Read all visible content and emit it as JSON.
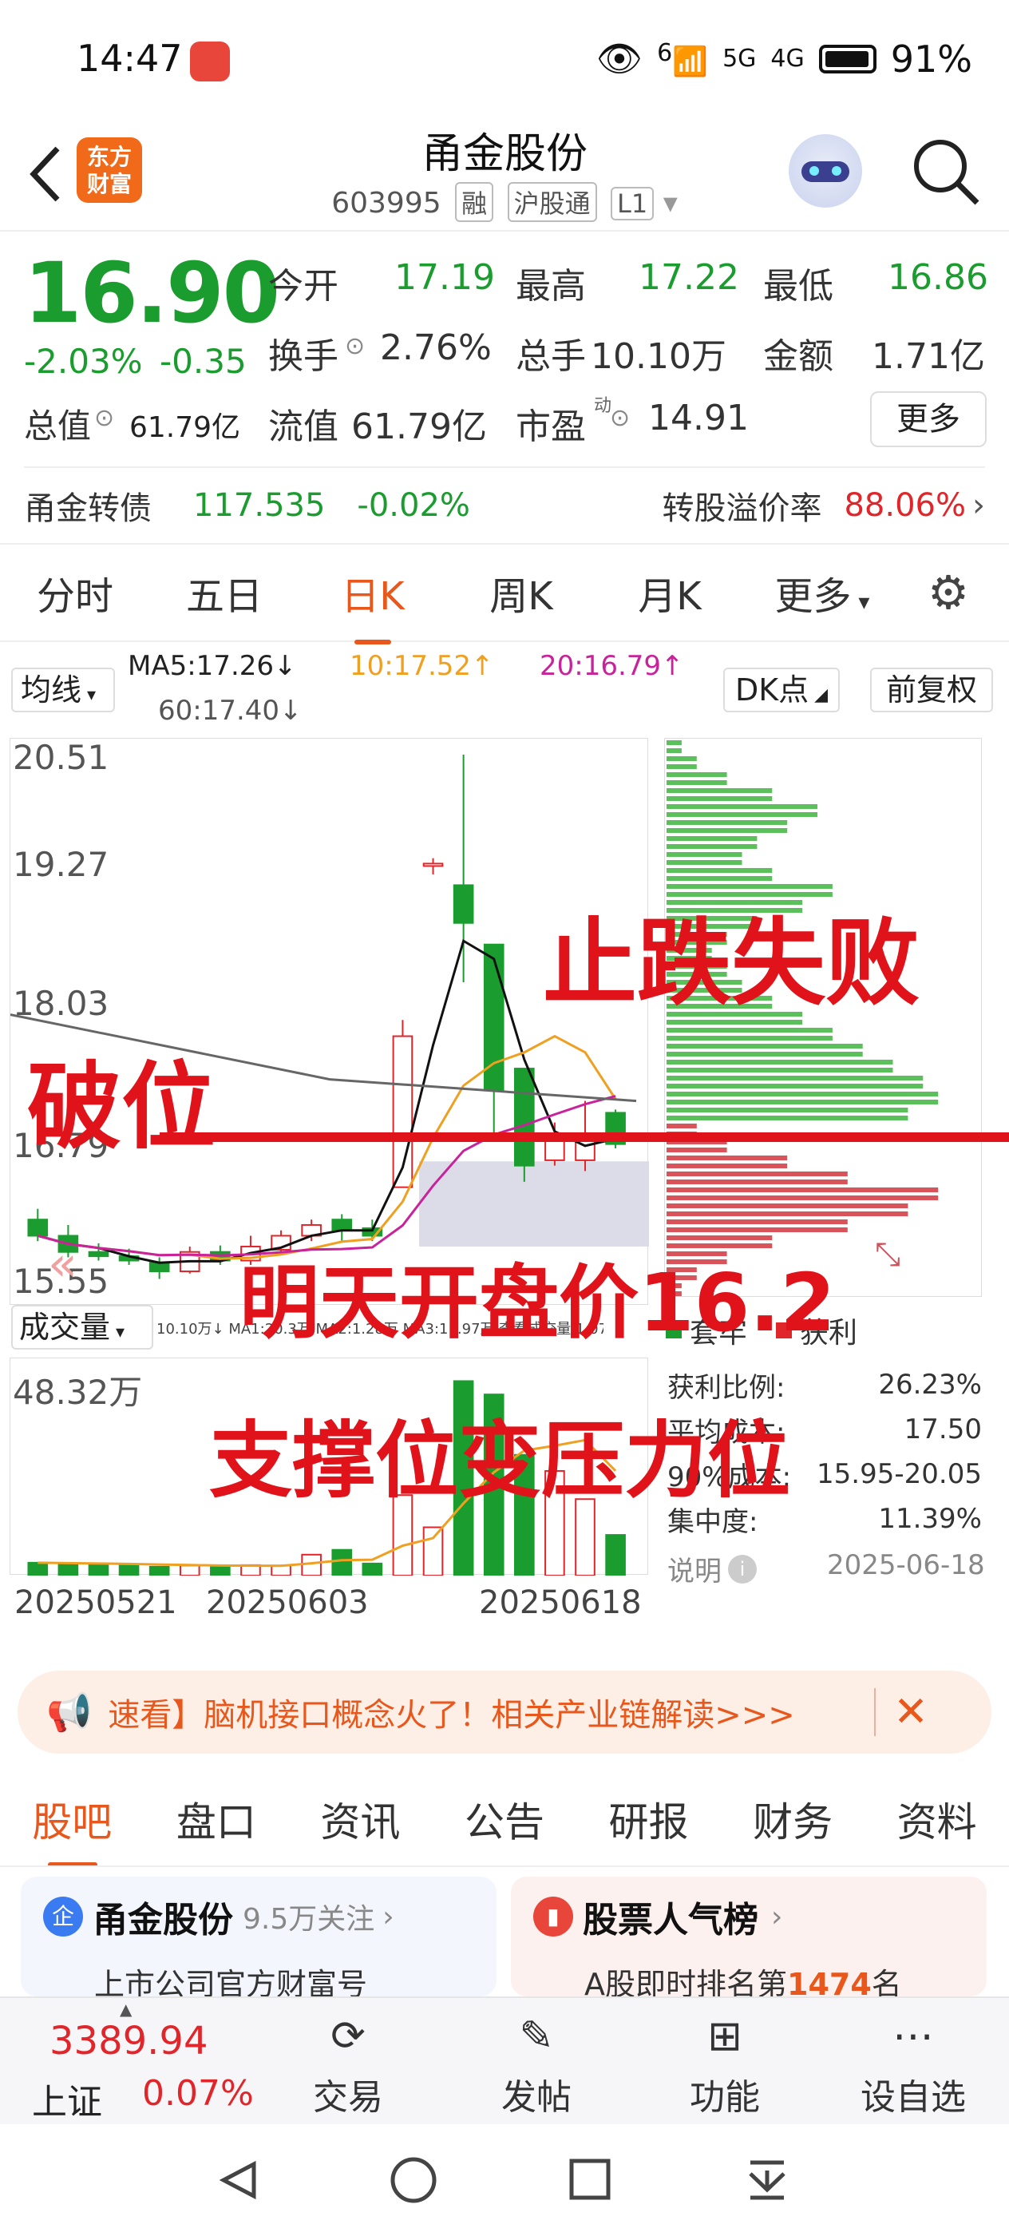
{
  "status": {
    "time": "14:47",
    "battery": "91%",
    "sig1": "6",
    "sig2": "5G",
    "sig3": "4G"
  },
  "header": {
    "title": "甬金股份",
    "code": "603995",
    "tags": [
      "融",
      "沪股通",
      "L1"
    ],
    "logo": [
      "东方",
      "财富"
    ]
  },
  "quote": {
    "price": "16.90",
    "change_pct": "-2.03%",
    "change": "-0.35",
    "open_label": "今开",
    "open": "17.19",
    "high_label": "最高",
    "high": "17.22",
    "low_label": "最低",
    "low": "16.86",
    "turnover_label": "换手",
    "turnover": "2.76%",
    "volume_label": "总手",
    "volume": "10.10万",
    "amount_label": "金额",
    "amount": "1.71亿",
    "mktcap_label": "总值",
    "mktcap": "61.79亿",
    "float_label": "流值",
    "float": "61.79亿",
    "pe_label": "市盈",
    "pe_sup": "动",
    "pe": "14.91",
    "more": "更多"
  },
  "bond": {
    "name": "甬金转债",
    "price": "117.535",
    "change": "-0.02%",
    "premium_label": "转股溢价率",
    "premium": "88.06%"
  },
  "ktabs": [
    "分时",
    "五日",
    "日K",
    "周K",
    "月K",
    "更多"
  ],
  "ma": {
    "selector": "均线",
    "ma5": "MA5:17.26↓",
    "ma10": "10:17.52↑",
    "ma20": "20:16.79↑",
    "ma60": "60:17.40↓",
    "dk": "DK点",
    "fq": "前复权"
  },
  "price_axis": [
    "20.51",
    "19.27",
    "18.03",
    "16.79",
    "15.55"
  ],
  "volume": {
    "selector": "成交量",
    "legend": "10.10万↓  MA1:20.3万  MA2:1.28万  MA3:11.97万  查看成交量  1.07万",
    "max": "48.32万"
  },
  "dates": [
    "20250521",
    "20250603",
    "20250618"
  ],
  "chip": {
    "legend_trap": "套牢",
    "legend_profit": "获利",
    "rows": [
      {
        "label": "获利比例:",
        "value": "26.23%"
      },
      {
        "label": "平均成本:",
        "value": "17.50"
      },
      {
        "label": "90%成本:",
        "value": "15.95-20.05"
      },
      {
        "label": "集中度:",
        "value": "11.39%"
      }
    ],
    "note_label": "说明",
    "date": "2025-06-18"
  },
  "overlays": {
    "t1": "止跌失败",
    "t2": "破位",
    "t3": "明天开盘价16.2",
    "t4": "支撑位变压力位"
  },
  "banner": {
    "text": "速看】脑机接口概念火了！相关产业链解读>>>"
  },
  "btabs": [
    "股吧",
    "盘口",
    "资讯",
    "公告",
    "研报",
    "财务",
    "资料"
  ],
  "cards": [
    {
      "name": "甬金股份",
      "follow": "9.5万关注",
      "sub": "上市公司官方财富号"
    },
    {
      "name": "股票人气榜",
      "sub_pre": "A股即时排名第",
      "rank": "1474",
      "sub_post": "名"
    }
  ],
  "nav": {
    "index_value": "3389.94",
    "index_name": "上证",
    "index_change": "0.07%",
    "items": [
      "交易",
      "发帖",
      "功能",
      "设自选"
    ]
  },
  "colors": {
    "up": "#e0262b",
    "down": "#1a9c2e",
    "accent": "#e8571b",
    "annotation": "#e0131b"
  },
  "chart_data": {
    "type": "candlestick",
    "x_start": "20250521",
    "x_end": "20250618",
    "ylim": [
      15.55,
      20.51
    ],
    "candles": [
      {
        "o": 16.2,
        "h": 16.3,
        "l": 16.0,
        "c": 16.05
      },
      {
        "o": 16.05,
        "h": 16.15,
        "l": 15.85,
        "c": 15.9
      },
      {
        "o": 15.9,
        "h": 15.98,
        "l": 15.82,
        "c": 15.86
      },
      {
        "o": 15.86,
        "h": 15.93,
        "l": 15.78,
        "c": 15.82
      },
      {
        "o": 15.8,
        "h": 15.85,
        "l": 15.65,
        "c": 15.72
      },
      {
        "o": 15.72,
        "h": 15.95,
        "l": 15.7,
        "c": 15.9
      },
      {
        "o": 15.9,
        "h": 15.96,
        "l": 15.78,
        "c": 15.82
      },
      {
        "o": 15.82,
        "h": 16.05,
        "l": 15.78,
        "c": 15.95
      },
      {
        "o": 15.92,
        "h": 16.1,
        "l": 15.9,
        "c": 16.05
      },
      {
        "o": 16.05,
        "h": 16.2,
        "l": 16.0,
        "c": 16.15
      },
      {
        "o": 16.2,
        "h": 16.25,
        "l": 16.0,
        "c": 16.1
      },
      {
        "o": 16.12,
        "h": 16.2,
        "l": 16.0,
        "c": 16.05
      },
      {
        "o": 16.5,
        "h": 18.05,
        "l": 16.5,
        "c": 17.9
      },
      {
        "o": 19.5,
        "h": 19.55,
        "l": 19.4,
        "c": 19.5
      },
      {
        "o": 19.3,
        "h": 20.51,
        "l": 18.4,
        "c": 18.95
      },
      {
        "o": 18.75,
        "h": 18.75,
        "l": 17.0,
        "c": 17.4
      },
      {
        "o": 17.6,
        "h": 17.6,
        "l": 16.55,
        "c": 16.7
      },
      {
        "o": 16.75,
        "h": 17.1,
        "l": 16.7,
        "c": 16.95
      },
      {
        "o": 16.75,
        "h": 17.3,
        "l": 16.65,
        "c": 17.0
      },
      {
        "o": 17.19,
        "h": 17.22,
        "l": 16.86,
        "c": 16.9
      }
    ],
    "volumes": [
      3.2,
      3.0,
      2.8,
      2.6,
      2.2,
      2.5,
      2.4,
      2.6,
      2.5,
      5.2,
      6.4,
      3.0,
      20.0,
      12.0,
      48.32,
      45.0,
      30.0,
      26.0,
      19.0,
      10.1
    ],
    "chips_trap": [
      0.05,
      0.1,
      0.2,
      0.35,
      0.5,
      0.4,
      0.3,
      0.25,
      0.35,
      0.55,
      0.45,
      0.3,
      0.2,
      0.15,
      0.2,
      0.25,
      0.35,
      0.45,
      0.55,
      0.65,
      0.75,
      0.85,
      0.9,
      0.8
    ],
    "chips_profit": [
      0.1,
      0.2,
      0.4,
      0.6,
      0.9,
      0.8,
      0.6,
      0.35,
      0.2,
      0.1,
      0.05
    ]
  }
}
